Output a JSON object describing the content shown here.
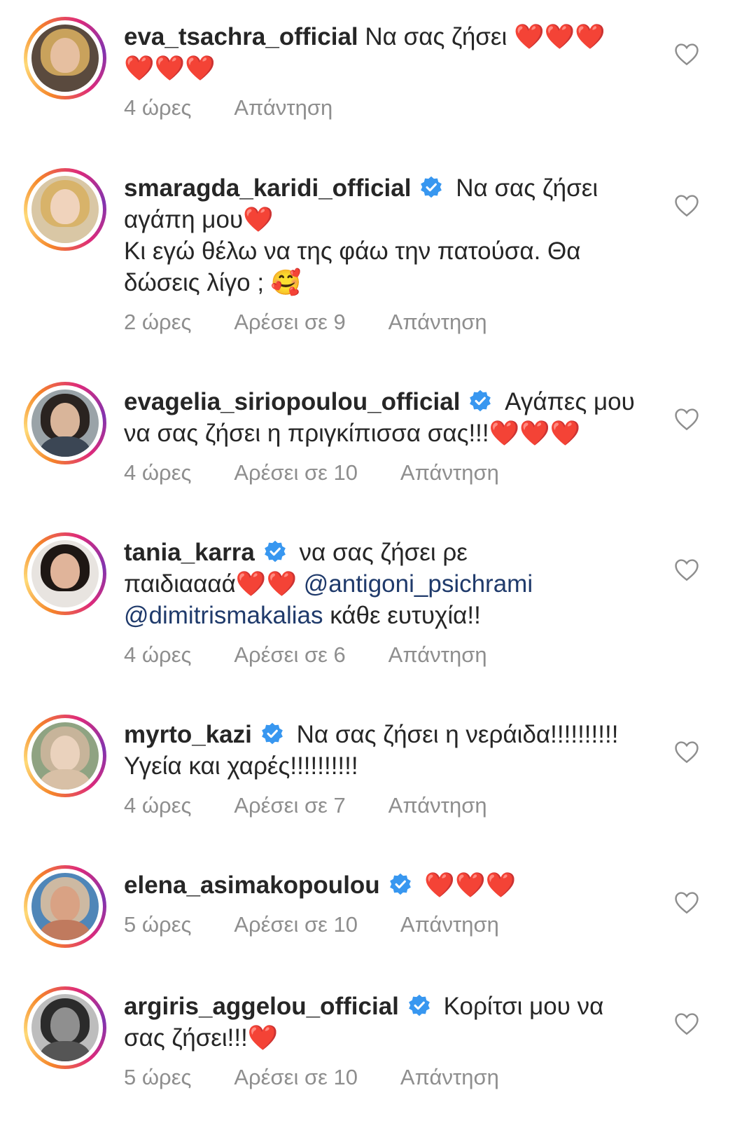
{
  "comments": [
    {
      "username": "eva_tsachra_official",
      "verified": false,
      "text_lines": [
        "Να σας ζήσει ❤️❤️❤️",
        "❤️❤️❤️"
      ],
      "meta": {
        "time": "4 ώρες",
        "likes": "",
        "reply": "Απάντηση"
      }
    },
    {
      "username": "smaragda_karidi_official",
      "verified": true,
      "text_lines": [
        "Να σας ζήσει",
        "αγάπη μου❤️",
        "Κι εγώ θέλω να της φάω την πατούσα. Θα",
        "δώσεις λίγο ; 🥰"
      ],
      "meta": {
        "time": "2 ώρες",
        "likes": "Αρέσει σε 9",
        "reply": "Απάντηση"
      }
    },
    {
      "username": "evagelia_siriopoulou_official",
      "verified": true,
      "text_lines": [
        "Αγάπες μου",
        "να σας ζήσει η πριγκίπισσα σας!!!❤️❤️❤️"
      ],
      "meta": {
        "time": "4 ώρες",
        "likes": "Αρέσει σε 10",
        "reply": "Απάντηση"
      }
    },
    {
      "username": "tania_karra",
      "verified": true,
      "text_lines": [
        "να σας ζήσει ρε",
        "παιδιαααά❤️❤️ ",
        "@antigoni_psichrami",
        "@dimitrismakalias",
        " κάθε ευτυχία!!"
      ],
      "meta": {
        "time": "4 ώρες",
        "likes": "Αρέσει σε 6",
        "reply": "Απάντηση"
      }
    },
    {
      "username": "myrto_kazi",
      "verified": true,
      "text_lines": [
        "Να σας ζήσει η νεράιδα!!!!!!!!!!",
        "Υγεία και χαρές!!!!!!!!!!"
      ],
      "meta": {
        "time": "4 ώρες",
        "likes": "Αρέσει σε 7",
        "reply": "Απάντηση"
      }
    },
    {
      "username": "elena_asimakopoulou",
      "verified": true,
      "text_lines": [
        "❤️❤️❤️"
      ],
      "meta": {
        "time": "5 ώρες",
        "likes": "Αρέσει σε 10",
        "reply": "Απάντηση"
      }
    },
    {
      "username": "argiris_aggelou_official",
      "verified": true,
      "text_lines": [
        "Κορίτσι μου να",
        "σας ζήσει!!!❤️"
      ],
      "meta": {
        "time": "5 ώρες",
        "likes": "Αρέσει σε 10",
        "reply": "Απάντηση"
      }
    }
  ],
  "icons": {
    "like": "heart-outline-icon",
    "verified": "verified-badge-icon"
  },
  "colors": {
    "verified": "#3897f0",
    "mention": "#1f3a6b",
    "meta": "#8e8e8e"
  }
}
